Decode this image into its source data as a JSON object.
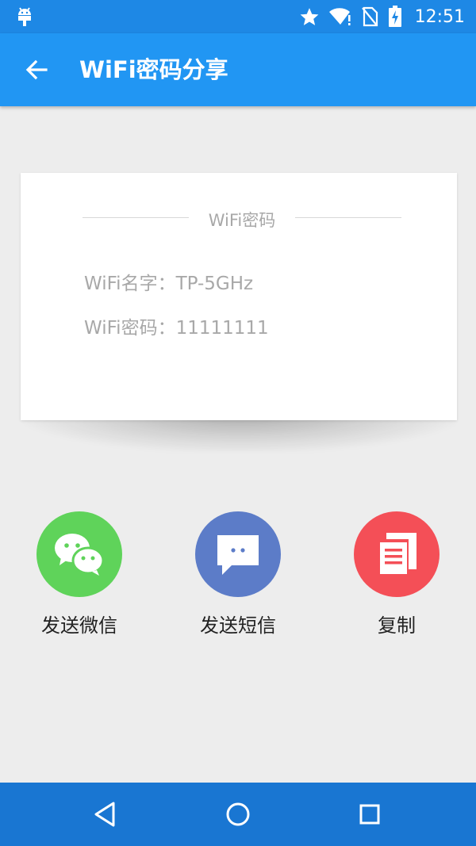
{
  "status_bar": {
    "time": "12:51",
    "icons": [
      "android-icon",
      "star-icon",
      "wifi-icon",
      "no-sim-icon",
      "battery-charging-icon"
    ]
  },
  "app_bar": {
    "title": "WiFi密码分享",
    "back_icon": "arrow-back-icon"
  },
  "card": {
    "header": "WiFi密码",
    "name_line": "WiFi名字：TP-5GHz",
    "password_line": "WiFi密码：11111111"
  },
  "actions": [
    {
      "label": "发送微信",
      "icon": "wechat-icon",
      "color": "#5fd35a"
    },
    {
      "label": "发送短信",
      "icon": "message-icon",
      "color": "#5c7cc8"
    },
    {
      "label": "复制",
      "icon": "copy-icon",
      "color": "#f44f57"
    }
  ],
  "nav_bar": {
    "buttons": [
      "back-triangle-icon",
      "home-circle-icon",
      "recents-square-icon"
    ]
  },
  "colors": {
    "status_bar": "#1e88e5",
    "app_bar": "#2196f3",
    "nav_bar": "#1976d2",
    "background": "#ededed"
  }
}
